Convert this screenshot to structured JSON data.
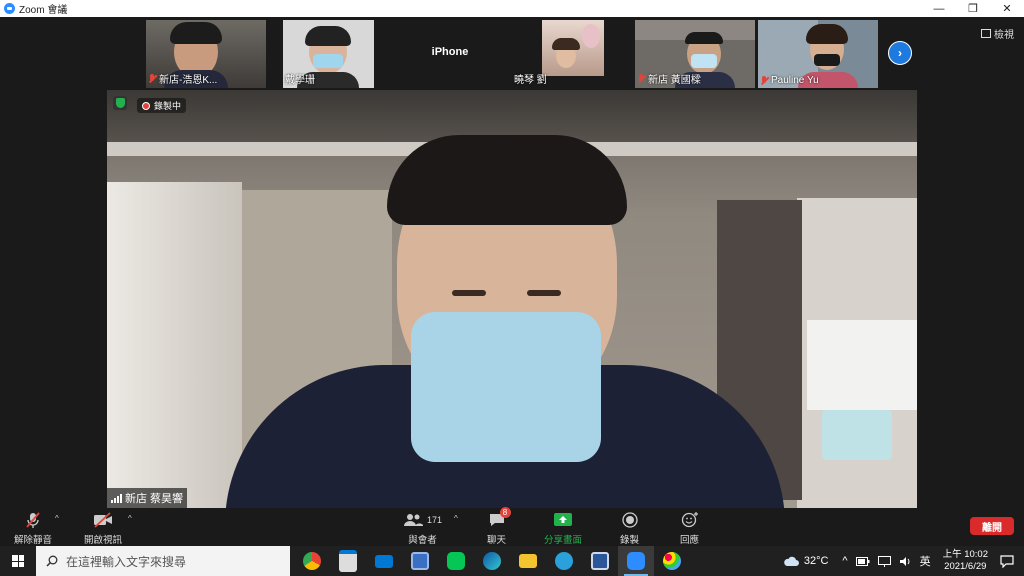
{
  "window": {
    "title": "Zoom 會議",
    "minimize_glyph": "—",
    "restore_glyph": "❐",
    "close_glyph": "✕"
  },
  "view_button": {
    "label": "檢視"
  },
  "thumbnails": [
    {
      "name": "新店-浩恩K...",
      "muted": true
    },
    {
      "name": "戴學珊",
      "muted": false
    },
    {
      "name": "iPhone",
      "muted": false,
      "video_off": true
    },
    {
      "name": "曉琴 劉",
      "muted": false
    },
    {
      "name": "新店 黃國樑",
      "muted": true
    },
    {
      "name": "Pauline Yu",
      "muted": true
    }
  ],
  "main_video": {
    "recording_label": "錄製中",
    "speaker_name": "新店 蔡昊響"
  },
  "toolbar": {
    "unmute_label": "解除靜音",
    "video_label": "開啟視訊",
    "participants_label": "與會者",
    "participants_count": "171",
    "chat_label": "聊天",
    "chat_badge": "8",
    "share_label": "分享畫面",
    "record_label": "錄製",
    "reactions_label": "回應",
    "end_label": "離開",
    "caret_glyph": "^"
  },
  "taskbar": {
    "search_placeholder": "在這裡輸入文字來搜尋",
    "weather": "32°C",
    "ime": "英",
    "time": "上午 10:02",
    "date": "2021/6/29",
    "tray_up_glyph": "^"
  },
  "colors": {
    "accent": "#2d8cff",
    "end_red": "#d92b2b",
    "share_green": "#22b14c",
    "muted_red": "#e0453b"
  }
}
